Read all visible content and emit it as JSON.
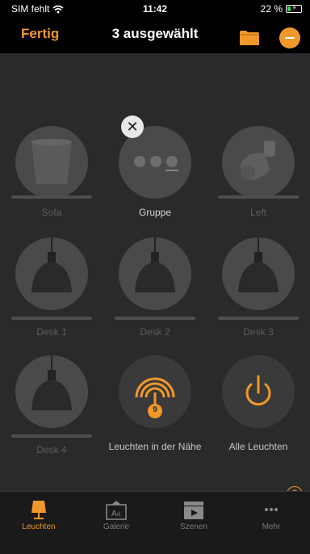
{
  "status": {
    "carrier": "SIM fehlt",
    "time": "11:42",
    "battery_text": "22 %",
    "battery_level": 0.22
  },
  "nav": {
    "done_label": "Fertig",
    "title": "3 ausgewählt"
  },
  "lights": [
    {
      "label": "Sofa"
    },
    {
      "label": "Gruppe"
    },
    {
      "label": "Left"
    },
    {
      "label": "Desk 1"
    },
    {
      "label": "Desk 2"
    },
    {
      "label": "Desk 3"
    },
    {
      "label": "Desk 4"
    }
  ],
  "actions": {
    "nearby_label": "Leuchten in der Nähe",
    "nearby_count": "9",
    "all_label": "Alle Leuchten"
  },
  "help": "?",
  "tabs": [
    {
      "label": "Leuchten",
      "icon": "lamp-icon",
      "active": true
    },
    {
      "label": "Galerie",
      "icon": "gallery-icon",
      "active": false
    },
    {
      "label": "Szenen",
      "icon": "scenes-icon",
      "active": false
    },
    {
      "label": "Mehr",
      "icon": "more-icon",
      "active": false
    }
  ],
  "colors": {
    "accent": "#f0982a",
    "background": "#2a2a2a",
    "tabbar": "#1a1a1a"
  }
}
